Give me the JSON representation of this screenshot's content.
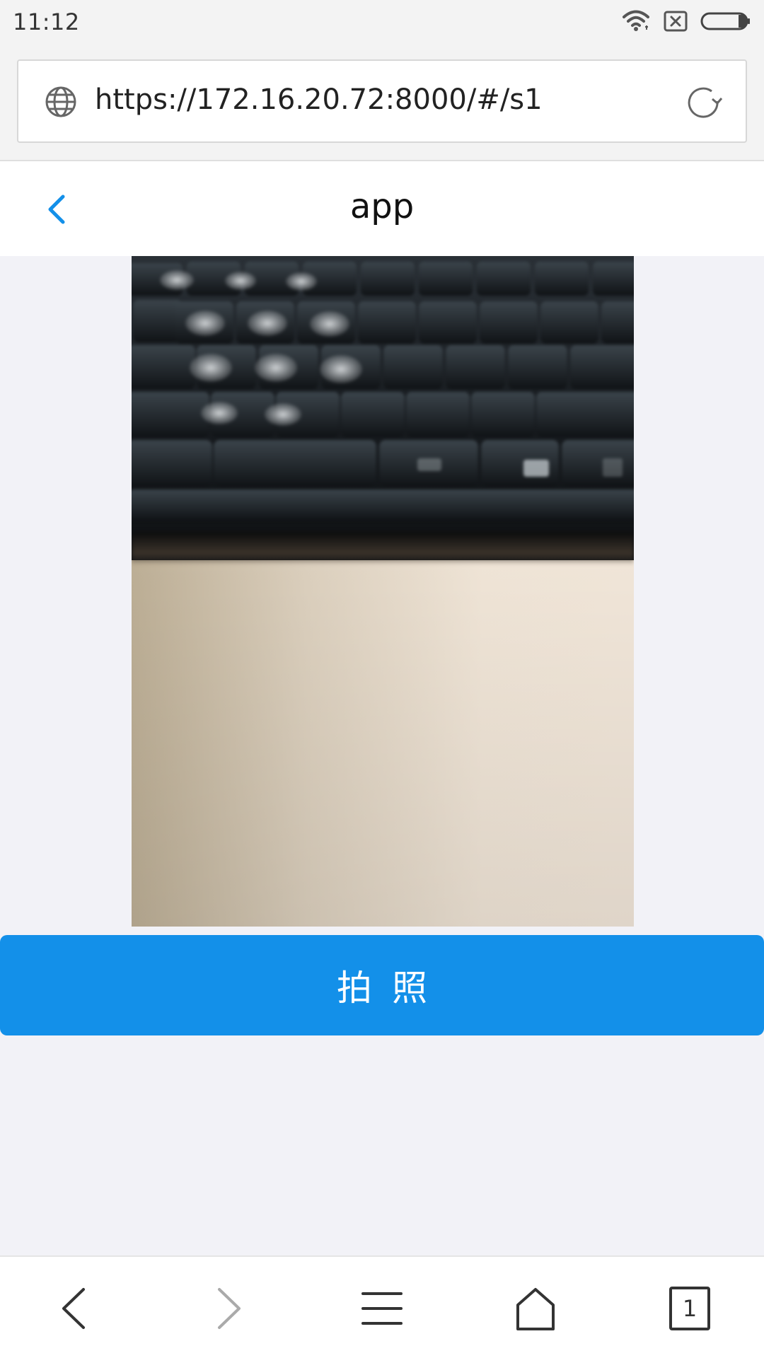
{
  "status_bar": {
    "time": "11:12",
    "icons": [
      "wifi-icon",
      "sim-error-icon",
      "battery-icon"
    ]
  },
  "browser": {
    "url": "https://172.16.20.72:8000/#/s1",
    "icons": [
      "globe-icon",
      "reload-icon"
    ]
  },
  "app": {
    "title": "app",
    "back_icon": "chevron-left-icon",
    "camera_preview": "camera-preview",
    "shoot_button_label": "拍照"
  },
  "bottom_nav": {
    "items": [
      "back-icon",
      "forward-icon",
      "menu-icon",
      "home-icon",
      "tabs-icon"
    ],
    "tabs_count": "1"
  },
  "colors": {
    "accent": "#1390e9",
    "page_background": "#f2f2f7"
  }
}
